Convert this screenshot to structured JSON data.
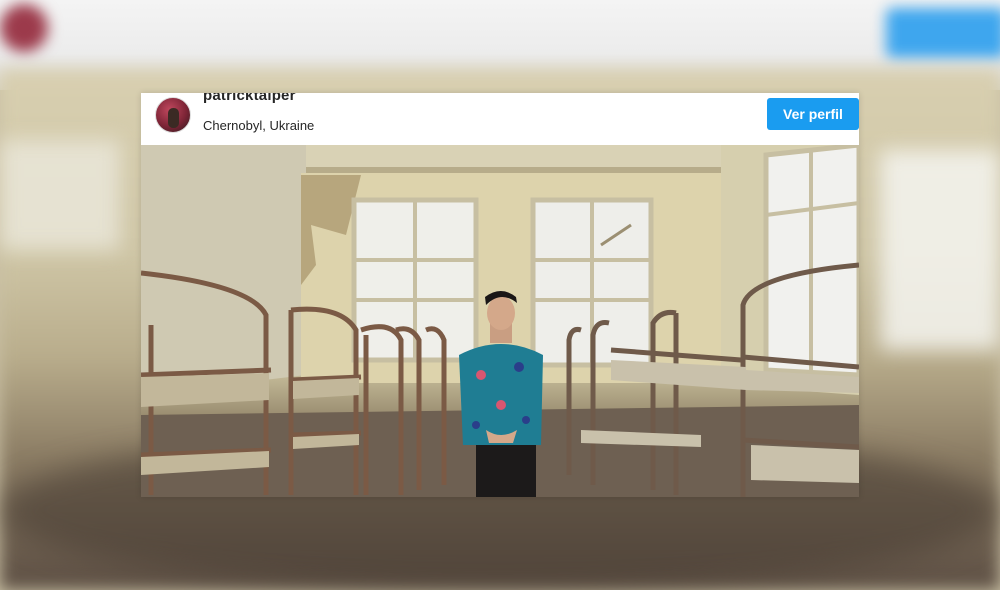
{
  "post": {
    "username": "patricktalper",
    "location": "Chernobyl, Ukraine",
    "view_profile_label": "Ver perfil"
  },
  "colors": {
    "button_blue": "#1a9cf0",
    "text_dark": "#262626"
  },
  "icons": {
    "avatar": "profile-photo"
  }
}
